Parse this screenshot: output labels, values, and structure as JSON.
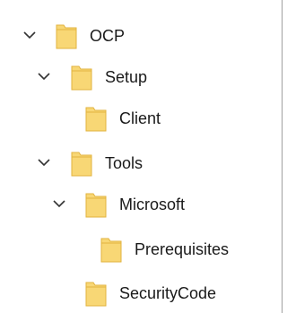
{
  "colors": {
    "folder_fill": "#F8D775",
    "folder_edge": "#E2B33F",
    "chevron": "#333333",
    "text": "#1a1a1a",
    "panel_border": "#a0a0a0"
  },
  "tree": {
    "nodes": [
      {
        "label": "OCP",
        "expanded": true,
        "level": 0,
        "icon": "folder-icon"
      },
      {
        "label": "Setup",
        "expanded": true,
        "level": 1,
        "icon": "folder-icon"
      },
      {
        "label": "Client",
        "expanded": false,
        "level": 2,
        "icon": "folder-icon"
      },
      {
        "label": "Tools",
        "expanded": true,
        "level": 1,
        "icon": "folder-icon"
      },
      {
        "label": "Microsoft",
        "expanded": true,
        "level": 2,
        "icon": "folder-icon"
      },
      {
        "label": "Prerequisites",
        "expanded": false,
        "level": 3,
        "icon": "folder-icon"
      },
      {
        "label": "SecurityCode",
        "expanded": false,
        "level": 2,
        "icon": "folder-icon"
      }
    ]
  }
}
